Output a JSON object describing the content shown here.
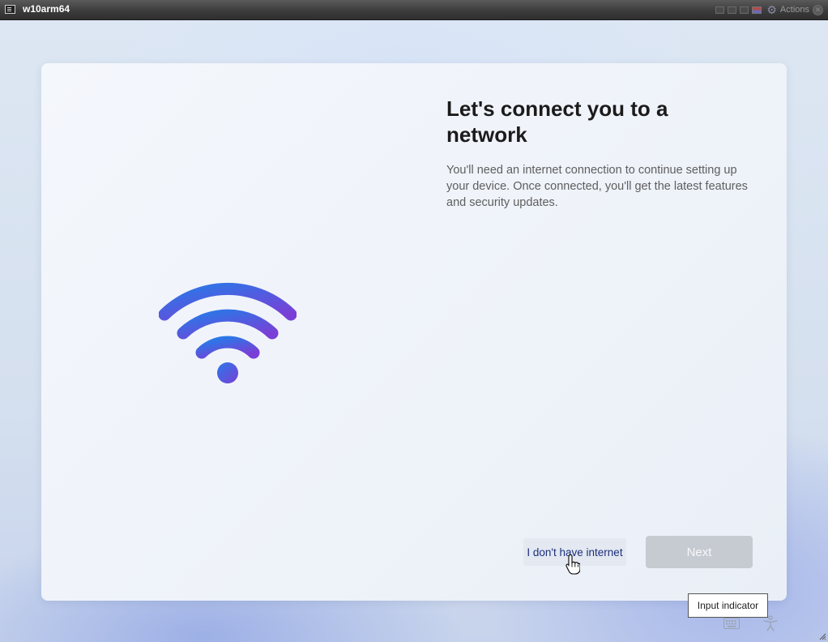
{
  "vm": {
    "title": "w10arm64",
    "actions_label": "Actions",
    "controls": [
      "window-icon",
      "window-icon",
      "window-icon",
      "flag-icon",
      "gear-icon",
      "close-icon"
    ]
  },
  "oobe": {
    "heading": "Let's connect you to a network",
    "description": "You'll need an internet connection to continue setting up your device. Once connected, you'll get the latest features and security updates.",
    "no_internet_label": "I don't have internet",
    "next_label": "Next",
    "next_enabled": false,
    "illustration": "wifi-icon",
    "colors": {
      "wifi_start": "#2f6fe0",
      "wifi_end": "#7a3fd6",
      "link": "#1b2f7a",
      "next_disabled": "#c6cad1"
    }
  },
  "tooltip": {
    "text": "Input indicator"
  },
  "tray": {
    "icons": [
      "keyboard-icon",
      "accessibility-icon"
    ]
  }
}
